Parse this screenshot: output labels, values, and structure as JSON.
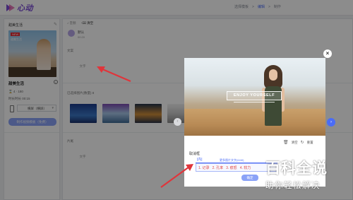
{
  "app": {
    "logo_text": "心动"
  },
  "breadcrumb": {
    "items": [
      "选择模板",
      "编辑",
      "制作"
    ],
    "active_index": 1
  },
  "left": {
    "title": "甜美生活",
    "edit_icon": "pencil-icon",
    "thumb": {
      "tag": "NEW",
      "subtitle": "甜美生活"
    },
    "name": "甜美生活",
    "meta": [
      "⌛ 4 · 180",
      "时长时长 00:15"
    ],
    "select_value": "横屏（横屏）",
    "button_label": "制作视频模板（免费）"
  },
  "main": {
    "tabs": [
      "音频",
      "清空"
    ],
    "message": {
      "name": "默认",
      "time": "00:20"
    },
    "section1": "文案",
    "section1_box": "文字",
    "section2": "已选择图片(数量) 8",
    "section3": "片尾",
    "section3_box": "文字"
  },
  "modal": {
    "banner_text": "ENJOY YOURSELF",
    "tools": [
      "清空",
      "重置"
    ],
    "label": "取消框",
    "input_value": "|内|",
    "input_hint": "更多图片文字(0/40)",
    "suggestions": [
      "1. 记录",
      "2. 孔率",
      "3. 痕怒",
      "4. 较力"
    ],
    "confirm_label": "确定"
  },
  "watermark": {
    "big": "百科全说",
    "small": "助你轻松解决"
  },
  "colors": {
    "accent": "#4a6cf7",
    "brand": "#7b4bd6",
    "arrow": "#e0353b"
  }
}
